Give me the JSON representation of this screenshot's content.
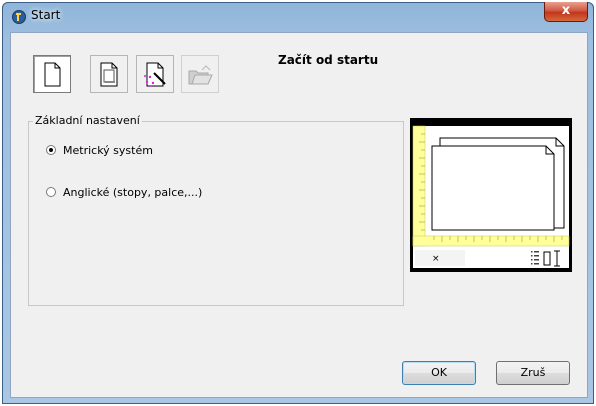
{
  "window": {
    "title": "Start",
    "close_label": "x"
  },
  "toolbar": {
    "buttons": [
      {
        "name": "start-from-scratch",
        "icon": "blank-page-icon",
        "selected": true
      },
      {
        "name": "use-template",
        "icon": "template-page-icon",
        "selected": false
      },
      {
        "name": "use-wizard",
        "icon": "wizard-wand-icon",
        "selected": false
      },
      {
        "name": "open-drawing",
        "icon": "folder-icon",
        "selected": false
      }
    ]
  },
  "heading": "Začít od startu",
  "settings_group": {
    "label": "Základní nastavení",
    "options": [
      {
        "label": "Metrický systém",
        "selected": true
      },
      {
        "label": "Anglické (stopy, palce,...)",
        "selected": false
      }
    ]
  },
  "preview": {
    "coord_marker": "×",
    "colors": {
      "ruler": "#ffff99",
      "background": "#000000",
      "sheet": "#ffffff"
    }
  },
  "footer": {
    "ok_label": "OK",
    "cancel_label": "Zruš"
  }
}
